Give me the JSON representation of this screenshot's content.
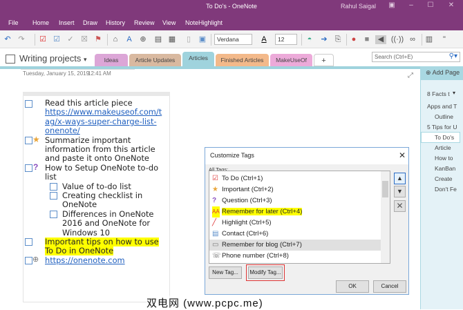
{
  "window": {
    "title": "To Do's  -  OneNote",
    "user": "Rahul Saigal"
  },
  "menu": [
    "File",
    "Home",
    "Insert",
    "Draw",
    "History",
    "Review",
    "View",
    "NoteHighlight"
  ],
  "ribbon": {
    "font": "Verdana",
    "size": "12"
  },
  "notebook": {
    "name": "Writing projects",
    "tabs": [
      {
        "label": "Ideas",
        "color": "#dca6d7"
      },
      {
        "label": "Article Updates",
        "color": "#d9b9a0"
      },
      {
        "label": "Articles",
        "color": "#9fd3dd"
      },
      {
        "label": "Finished Articles",
        "color": "#f3b98a"
      },
      {
        "label": "MakeUseOf",
        "color": "#ecaad9"
      },
      {
        "label": "+",
        "color": "#ffffff"
      }
    ],
    "search_placeholder": "Search (Ctrl+E)"
  },
  "pages": {
    "add_label": "Add Page",
    "items": [
      "8 Facts t",
      "Apps and T",
      "Outline",
      "5 Tips for U",
      "To Do's",
      "Article",
      "How to",
      "KanBan",
      "Create",
      "Don't Fe"
    ],
    "selected": "To Do's"
  },
  "note": {
    "date": "Tuesday, January 15, 2019",
    "time": "12:41 AM",
    "lines": [
      "Read this article piece",
      "https://www.makeuseof.com/t",
      "ag/x-ways-super-charge-list-",
      "onenote/",
      "Summarize important",
      "information from this article",
      "and paste it onto OneNote",
      "How to Setup OneNote to-do",
      "list",
      "Value of to-do list",
      "Creating checklist in",
      "OneNote",
      "Differences in OneNote",
      "2016 and OneNote for",
      "Windows 10",
      "Important tips on how to use",
      "To Do in OneNote",
      "https://onenote.com"
    ]
  },
  "dialog": {
    "title": "Customize Tags",
    "all_tags_label": "All Tags:",
    "tags": [
      {
        "label": "To Do (Ctrl+1)",
        "icon": "checkbox-icon"
      },
      {
        "label": "Important (Ctrl+2)",
        "icon": "star-icon"
      },
      {
        "label": "Question (Ctrl+3)",
        "icon": "question-icon"
      },
      {
        "label": "Remember for later (Ctrl+4)",
        "icon": "font-highlight-icon"
      },
      {
        "label": "Highlight (Ctrl+5)",
        "icon": "highlighter-icon"
      },
      {
        "label": "Contact (Ctrl+6)",
        "icon": "contact-card-icon"
      },
      {
        "label": "Remember for blog (Ctrl+7)",
        "icon": "speech-bubble-icon"
      },
      {
        "label": "Phone number (Ctrl+8)",
        "icon": "phone-icon"
      }
    ],
    "new_tag": "New Tag...",
    "modify_tag": "Modify Tag...",
    "ok": "OK",
    "cancel": "Cancel"
  },
  "watermark": "双电网 (www.pcpc.me)"
}
